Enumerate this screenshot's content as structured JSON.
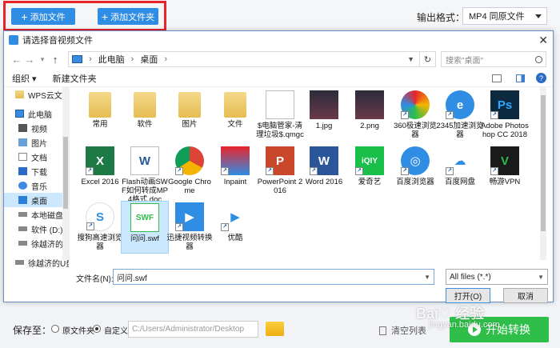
{
  "toolbar": {
    "add_file": "添加文件",
    "add_folder": "添加文件夹",
    "output_label": "输出格式：",
    "output_value": "MP4  同原文件"
  },
  "dialog": {
    "title": "请选择音视频文件",
    "address": {
      "root": "此电脑",
      "current": "桌面"
    },
    "search_placeholder": "搜索\"桌面\"",
    "organize": "组织 ▾",
    "new_folder": "新建文件夹",
    "help": "?",
    "sidebar": [
      {
        "label": "WPS云文档",
        "icon": "folder-icon"
      },
      {
        "label": "此电脑",
        "icon": "pc-icon"
      },
      {
        "label": "视频",
        "icon": "video-icon"
      },
      {
        "label": "图片",
        "icon": "picture-icon"
      },
      {
        "label": "文档",
        "icon": "document-icon"
      },
      {
        "label": "下载",
        "icon": "download-icon"
      },
      {
        "label": "音乐",
        "icon": "music-icon"
      },
      {
        "label": "桌面",
        "icon": "desktop-icon"
      },
      {
        "label": "本地磁盘 (C",
        "icon": "drive-icon"
      },
      {
        "label": "软件 (D:)",
        "icon": "drive-icon"
      },
      {
        "label": "徐越济的U盘",
        "icon": "drive-icon"
      },
      {
        "label": "徐越济的U盘",
        "icon": "drive-icon"
      }
    ],
    "files": [
      {
        "name": "常用",
        "icon": "folder-icon"
      },
      {
        "name": "软件",
        "icon": "folder-icon"
      },
      {
        "name": "图片",
        "icon": "folder-icon"
      },
      {
        "name": "文件",
        "icon": "folder-icon"
      },
      {
        "name": "$电脑管家-清理垃圾$.qmgc",
        "icon": "blank-file-icon"
      },
      {
        "name": "1.jpg",
        "icon": "image-icon"
      },
      {
        "name": "2.png",
        "icon": "image-icon"
      },
      {
        "name": "360极速浏览器",
        "icon": "360-browser-icon"
      },
      {
        "name": "2345加速浏览器",
        "icon": "2345-browser-icon"
      },
      {
        "name": "Adobe Photoshop CC 2018",
        "icon": "photoshop-icon"
      },
      {
        "name": "Excel 2016",
        "icon": "excel-icon"
      },
      {
        "name": "Flash动画SWF如何转成MP4格式.doc",
        "icon": "word-doc-icon"
      },
      {
        "name": "Google Chrome",
        "icon": "chrome-icon"
      },
      {
        "name": "Inpaint",
        "icon": "inpaint-icon"
      },
      {
        "name": "PowerPoint 2016",
        "icon": "powerpoint-icon"
      },
      {
        "name": "Word 2016",
        "icon": "word-icon"
      },
      {
        "name": "爱奇艺",
        "icon": "iqiyi-icon"
      },
      {
        "name": "百度浏览器",
        "icon": "baidu-browser-icon"
      },
      {
        "name": "百度网盘",
        "icon": "baidu-netdisk-icon"
      },
      {
        "name": "畅游VPN",
        "icon": "vpn-icon"
      },
      {
        "name": "搜狗高速浏览器",
        "icon": "sogou-browser-icon"
      },
      {
        "name": "问问.swf",
        "icon": "swf-icon"
      },
      {
        "name": "迅捷视频转换器",
        "icon": "video-converter-icon"
      },
      {
        "name": "优酷",
        "icon": "youku-icon"
      }
    ],
    "filename_label": "文件名(N):",
    "filename_value": "问问.swf",
    "filetype_value": "All files (*.*)",
    "open": "打开(O)",
    "cancel": "取消"
  },
  "bottom": {
    "save_label": "保存至：",
    "option_source": "原文件夹",
    "option_custom": "自定义",
    "path": "C:/Users/Administrator/Desktop",
    "clear": "清空列表",
    "start": "开始转换"
  },
  "watermark": {
    "line1": "Bai♡ 经验",
    "line2": "jingyan.baidu.com"
  },
  "colors": {
    "accent": "#2f8de4",
    "start": "#2fbe4a",
    "highlight": "#e8242b",
    "selection": "#cce8ff"
  }
}
